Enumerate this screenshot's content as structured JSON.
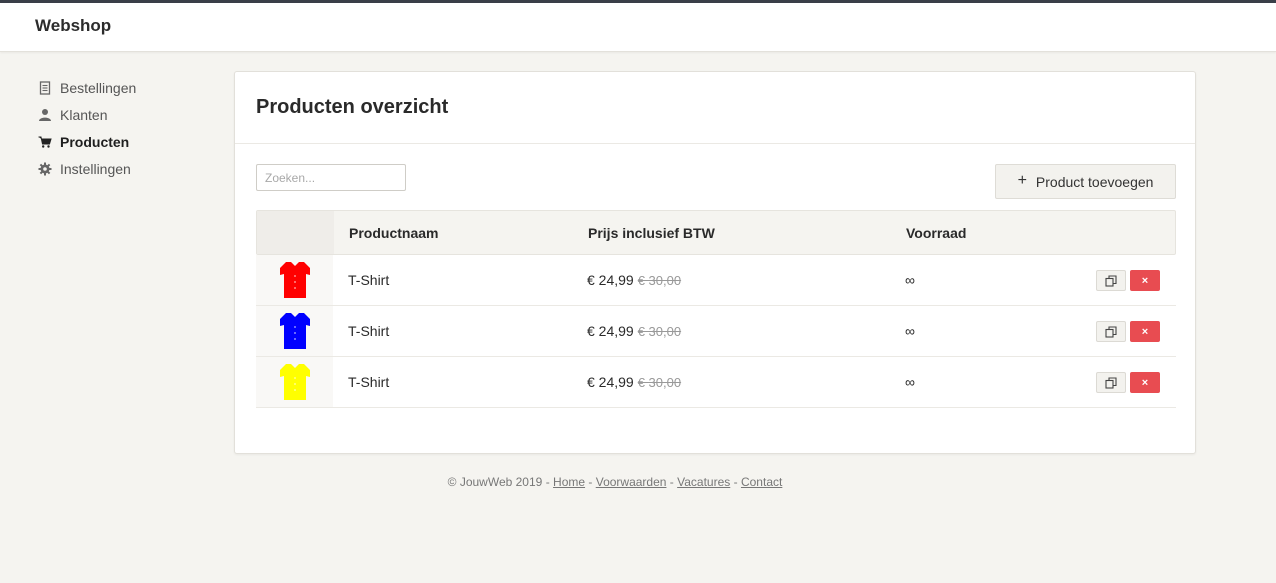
{
  "header": {
    "brand": "Webshop"
  },
  "sidebar": {
    "items": [
      {
        "label": "Bestellingen",
        "icon": "document-icon"
      },
      {
        "label": "Klanten",
        "icon": "user-icon"
      },
      {
        "label": "Producten",
        "icon": "cart-icon",
        "active": true
      },
      {
        "label": "Instellingen",
        "icon": "gear-icon"
      }
    ]
  },
  "main": {
    "title": "Producten overzicht",
    "search": {
      "placeholder": "Zoeken..."
    },
    "add_button": {
      "label": "Product toevoegen",
      "icon": "plus-icon"
    },
    "table": {
      "headers": [
        "",
        "Productnaam",
        "Prijs inclusief BTW",
        "Voorraad"
      ],
      "rows": [
        {
          "color": "#ff0000",
          "name": "T-Shirt",
          "price": "€ 24,99",
          "old_price": "€ 30,00",
          "stock": "∞"
        },
        {
          "color": "#0000ff",
          "name": "T-Shirt",
          "price": "€ 24,99",
          "old_price": "€ 30,00",
          "stock": "∞"
        },
        {
          "color": "#ffff00",
          "name": "T-Shirt",
          "price": "€ 24,99",
          "old_price": "€ 30,00",
          "stock": "∞"
        }
      ],
      "delete_label": "×"
    }
  },
  "footer": {
    "copyright": "© JouwWeb 2019",
    "separator": "-",
    "links": [
      "Home",
      "Voorwaarden",
      "Vacatures",
      "Contact"
    ]
  },
  "colors": {
    "delete": "#e84c51",
    "background": "#f5f4f0"
  }
}
